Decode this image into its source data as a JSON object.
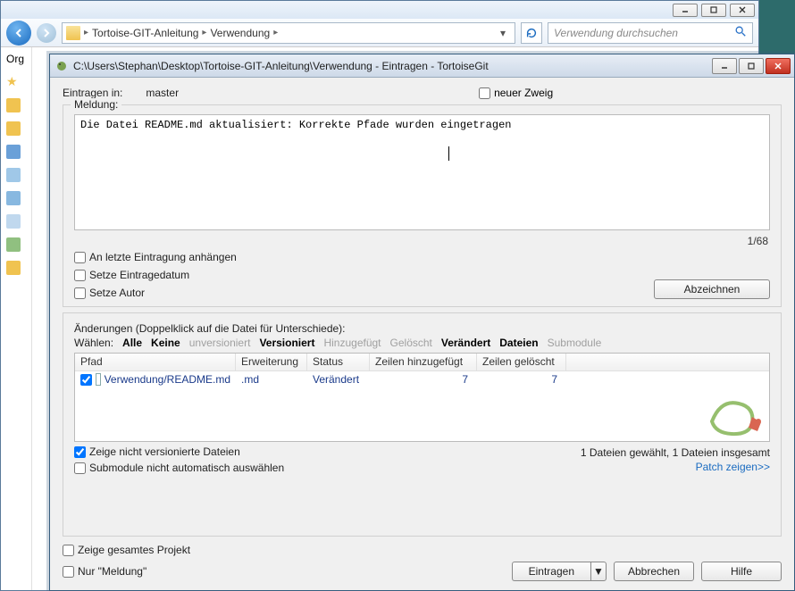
{
  "explorer": {
    "breadcrumb": {
      "part1": "Tortoise-GIT-Anleitung",
      "part2": "Verwendung"
    },
    "search_placeholder": "Verwendung durchsuchen",
    "sidebar_label": "Org"
  },
  "dialog": {
    "title": "C:\\Users\\Stephan\\Desktop\\Tortoise-GIT-Anleitung\\Verwendung - Eintragen - TortoiseGit",
    "commit_to_label": "Eintragen in:",
    "branch": "master",
    "new_branch_label": "neuer Zweig",
    "message_group_label": "Meldung:",
    "message_text": "Die Datei README.md aktualisiert: Korrekte Pfade wurden eingetragen",
    "message_counter": "1/68",
    "amend_label": "An letzte Eintragung anhängen",
    "set_date_label": "Setze Eintragedatum",
    "set_author_label": "Setze Autor",
    "signoff_label": "Abzeichnen",
    "changes_desc": "Änderungen (Doppelklick auf die Datei für Unterschiede):",
    "filters": {
      "select_label": "Wählen:",
      "all": "Alle",
      "none": "Keine",
      "unversioned": "unversioniert",
      "versioned": "Versioniert",
      "added": "Hinzugefügt",
      "deleted": "Gelöscht",
      "modified": "Verändert",
      "files": "Dateien",
      "submodule": "Submodule"
    },
    "columns": {
      "path": "Pfad",
      "ext": "Erweiterung",
      "status": "Status",
      "lines_added": "Zeilen hinzugefügt",
      "lines_deleted": "Zeilen gelöscht"
    },
    "file_row": {
      "path": "Verwendung/README.md",
      "ext": ".md",
      "status": "Verändert",
      "added": "7",
      "deleted": "7"
    },
    "show_unversioned_label": "Zeige nicht versionierte Dateien",
    "no_auto_submodule_label": "Submodule nicht automatisch auswählen",
    "status_count": "1 Dateien gewählt, 1 Dateien insgesamt",
    "patch_link": "Patch zeigen>>",
    "show_whole_project_label": "Zeige gesamtes Projekt",
    "only_message_label": "Nur \"Meldung\"",
    "commit_btn": "Eintragen",
    "cancel_btn": "Abbrechen",
    "help_btn": "Hilfe"
  }
}
